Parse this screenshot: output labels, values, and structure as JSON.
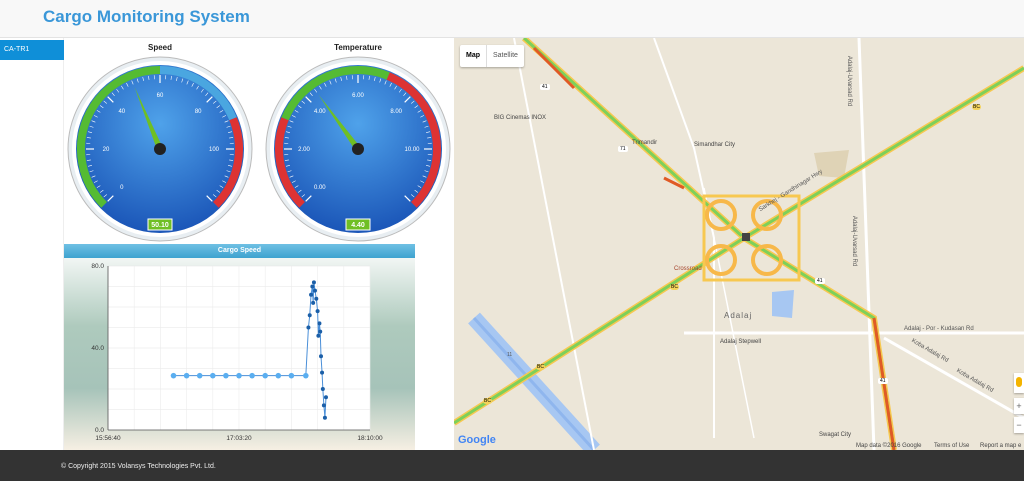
{
  "app": {
    "title": "Cargo Monitoring System"
  },
  "sidebar": {
    "items": [
      {
        "label": "CA-TR1"
      }
    ]
  },
  "gauges": [
    {
      "title": "Speed",
      "value": 50.1,
      "display": "50.10",
      "min": 0,
      "max": 120,
      "tick_labels": [
        "0",
        "20",
        "40",
        "60",
        "80",
        "100"
      ],
      "bands": [
        {
          "from": 0,
          "to": 60,
          "color": "#55bb33"
        },
        {
          "from": 60,
          "to": 90,
          "color": "#4aa6e0"
        },
        {
          "from": 90,
          "to": 120,
          "color": "#dd3333"
        }
      ]
    },
    {
      "title": "Temperature",
      "value": 4.4,
      "display": "4.40",
      "min": 0,
      "max": 12,
      "tick_labels": [
        "0.00",
        "2.00",
        "4.00",
        "6.00",
        "8.00",
        "10.00"
      ],
      "bands": [
        {
          "from": 0,
          "to": 3,
          "color": "#dd3333"
        },
        {
          "from": 3,
          "to": 7,
          "color": "#55bb33"
        },
        {
          "from": 7,
          "to": 12,
          "color": "#dd3333"
        }
      ]
    }
  ],
  "chart_data": {
    "type": "line",
    "title": "Cargo Speed",
    "xlabel": "",
    "ylabel": "",
    "x_tick_labels": [
      "15:56:40",
      "17:03:20",
      "18:10:00"
    ],
    "y_tick_labels": [
      "0.0",
      "40.0",
      "80.0"
    ],
    "ylim": [
      0,
      80
    ],
    "grid": true,
    "series": [
      {
        "points": [
          [
            0.25,
            26.5
          ],
          [
            0.3,
            26.5
          ],
          [
            0.35,
            26.5
          ],
          [
            0.4,
            26.5
          ],
          [
            0.45,
            26.5
          ],
          [
            0.5,
            26.5
          ],
          [
            0.55,
            26.5
          ],
          [
            0.6,
            26.5
          ],
          [
            0.65,
            26.5
          ],
          [
            0.7,
            26.5
          ],
          [
            0.755,
            26.5
          ],
          [
            0.765,
            50
          ],
          [
            0.77,
            56
          ],
          [
            0.775,
            66
          ],
          [
            0.78,
            70
          ],
          [
            0.783,
            62
          ],
          [
            0.786,
            72
          ],
          [
            0.79,
            68
          ],
          [
            0.795,
            64
          ],
          [
            0.8,
            58
          ],
          [
            0.803,
            46
          ],
          [
            0.807,
            52
          ],
          [
            0.81,
            48
          ],
          [
            0.813,
            36
          ],
          [
            0.817,
            28
          ],
          [
            0.82,
            20
          ],
          [
            0.824,
            12
          ],
          [
            0.828,
            6
          ],
          [
            0.832,
            16
          ]
        ]
      }
    ]
  },
  "map": {
    "tabs": [
      "Map",
      "Satellite"
    ],
    "labels": {
      "big_cinemas": "BIG Cinemas INOX",
      "trimandir": "Trimandir",
      "simandhar": "Simandhar City",
      "sarkhej": "Sarkhej - Gandhinagar Hwy",
      "crossroad": "Crossroad",
      "adalaj": "Adalaj",
      "stepwell": "Adalaj Stepwell",
      "adalaj_road": "Adalaj - Por - Kudasan Rd",
      "koba_road": "Koba Adalaj Rd",
      "koba_road2": "Koba Adalaj Rd",
      "uvarsad": "Adalaj-Uvarsad Rd",
      "uvarsad2": "Adalaj-Uvarsad Rd",
      "swagat": "Swagat City",
      "google": "Google",
      "attribution": "Map data ©2016 Google",
      "terms": "Terms of Use",
      "report": "Report a map e",
      "shield_41a": "41",
      "shield_41b": "41",
      "shield_41c": "41",
      "shield_71": "71",
      "shield_11": "11",
      "shield_bc1": "BC",
      "shield_bc2": "BC",
      "shield_bc3": "BC",
      "shield_bc4": "BC"
    },
    "zoom_in": "+",
    "zoom_out": "−"
  },
  "footer": {
    "copyright": "© Copyright 2015 Volansys Technologies Pvt. Ltd."
  }
}
